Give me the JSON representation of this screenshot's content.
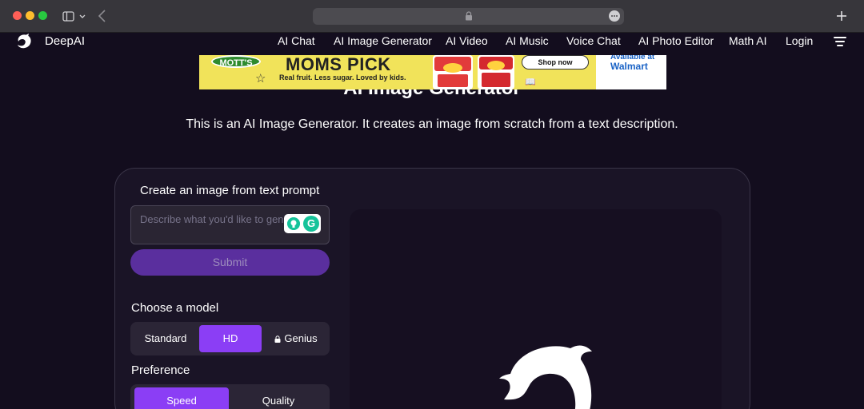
{
  "browser": {
    "controls": {
      "sidebar_icon": "sidebar-icon",
      "back_icon": "chevron-left-icon",
      "new_tab_icon": "plus-icon"
    }
  },
  "nav": {
    "brand": "DeepAI",
    "links": [
      "AI Chat",
      "AI Image Generator",
      "AI Video",
      "AI Music",
      "Voice Chat",
      "AI Photo Editor",
      "Math AI",
      "Login"
    ]
  },
  "ad": {
    "brand_logo": "MOTT'S",
    "headline": "MOMS PICK",
    "tagline": "Real fruit. Less sugar. Loved by kids.",
    "cta": "Shop now",
    "available": "Available at",
    "retailer": "Walmart"
  },
  "page": {
    "title": "AI Image Generator",
    "description": "This is an AI Image Generator. It creates an image from scratch from a text description."
  },
  "form": {
    "heading": "Create an image from text prompt",
    "prompt_placeholder": "Describe what you'd like to generate",
    "prompt_value": "",
    "submit_label": "Submit",
    "model_label": "Choose a model",
    "models": [
      "Standard",
      "HD",
      "Genius"
    ],
    "selected_model": "HD",
    "preference_label": "Preference",
    "preferences": [
      "Speed",
      "Quality"
    ],
    "selected_preference": "Speed"
  },
  "colors": {
    "accent": "#8b3ef5",
    "submit_bg": "#5a2f9e",
    "background": "#130d1e"
  }
}
